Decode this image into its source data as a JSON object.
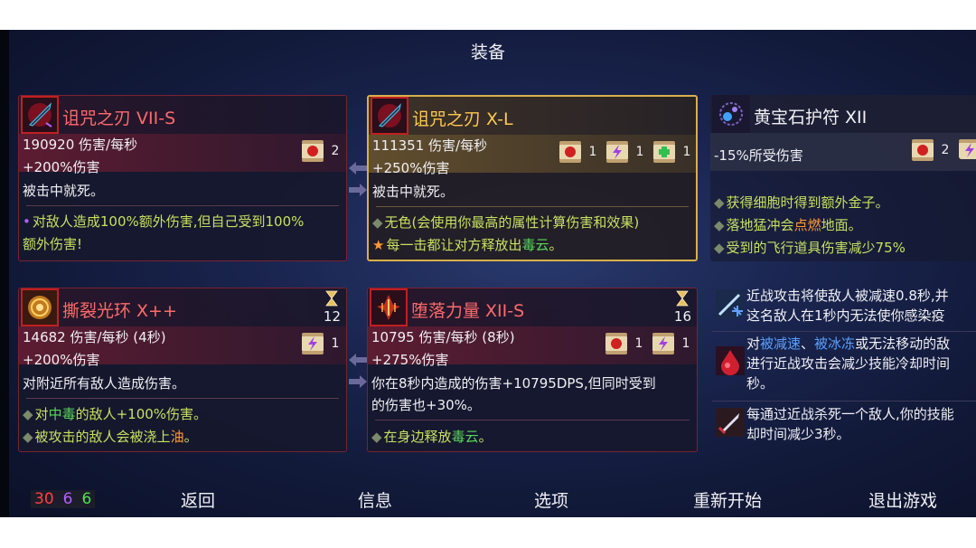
{
  "screen": {
    "title": "装备"
  },
  "cards": {
    "c1": {
      "name": "诅咒之刃 VII-S",
      "dps": "190920 伤害/每秒",
      "damage": "+200%伤害",
      "desc": "被击中就死。",
      "bullet1": "对敌人造成100%额外伤害,但自己受到100%",
      "bullet1b": "额外伤害!",
      "scrolls": [
        {
          "icon": "fist-scroll-icon",
          "count": "2"
        }
      ]
    },
    "c2": {
      "name": "诅咒之刃 X-L",
      "dps": "111351 伤害/每秒",
      "damage": "+250%伤害",
      "desc": "被击中就死。",
      "bullet1": "无色(会使用你最高的属性计算伤害和效果)",
      "bullet2_pre": "每一击都让对方释放出",
      "bullet2_hl": "毒云",
      "bullet2_post": "。",
      "scrolls": [
        {
          "icon": "fist-scroll-icon",
          "count": "1"
        },
        {
          "icon": "lightning-scroll-icon",
          "count": "1"
        },
        {
          "icon": "cross-scroll-icon",
          "count": "1"
        }
      ]
    },
    "c3": {
      "name": "黄宝石护符 XII",
      "effect": "-15%所受伤害",
      "bullet1": "获得细胞时得到额外金子。",
      "bullet2_pre": "落地猛冲会",
      "bullet2_hl": "点燃",
      "bullet2_post": "地面。",
      "bullet3": "受到的飞行道具伤害减少75%",
      "scrolls": [
        {
          "icon": "fist-scroll-icon",
          "count": "2"
        }
      ]
    },
    "c4": {
      "name": "撕裂光环 X++",
      "timer": "12",
      "dps": "14682 伤害/每秒 (4秒)",
      "damage": "+200%伤害",
      "desc": "对附近所有敌人造成伤害。",
      "bullet1_pre": "对",
      "bullet1_hl": "中毒",
      "bullet1_post": "的敌人+100%伤害。",
      "bullet2_pre": "被攻击的敌人会被浇上",
      "bullet2_hl": "油",
      "bullet2_post": "。",
      "scrolls": [
        {
          "icon": "lightning-scroll-icon",
          "count": "1"
        }
      ]
    },
    "c5": {
      "name": "堕落力量 XII-S",
      "timer": "16",
      "dps": "10795 伤害/每秒 (8秒)",
      "damage": "+275%伤害",
      "desc1": "你在8秒内造成的伤害+10795DPS,但同时受到",
      "desc2": "的伤害也+30%。",
      "bullet1_pre": "在身边释放",
      "bullet1_hl": "毒云",
      "bullet1_post": "。",
      "scrolls": [
        {
          "icon": "fist-scroll-icon",
          "count": "1"
        },
        {
          "icon": "lightning-scroll-icon",
          "count": "1"
        }
      ]
    }
  },
  "passives": {
    "p1_l1": "近战攻击将使敌人被减速0.8秒,并",
    "p1_l2": "这名敌人在1秒内无法使你感染疫",
    "p2_l1_a": "对",
    "p2_l1_b": "被减速",
    "p2_l1_c": "、",
    "p2_l1_d": "被冰冻",
    "p2_l1_e": "或无法移动的敌",
    "p2_l2": "进行近战攻击会减少技能冷却时间",
    "p2_l3": "秒。",
    "p3_l1": "每通过近战杀死一个敌人,你的技能",
    "p3_l2": "却时间减少3秒。"
  },
  "footer": {
    "stat_red": "30",
    "stat_purple": "6",
    "stat_green": "6",
    "menu": {
      "back": "返回",
      "info": "信息",
      "options": "选项",
      "restart": "重新开始",
      "quit": "退出游戏"
    }
  },
  "colors": {
    "brutality": "#ff4040",
    "tactics": "#b060ff",
    "survival": "#50e050",
    "legendary": "#d8b04a"
  }
}
